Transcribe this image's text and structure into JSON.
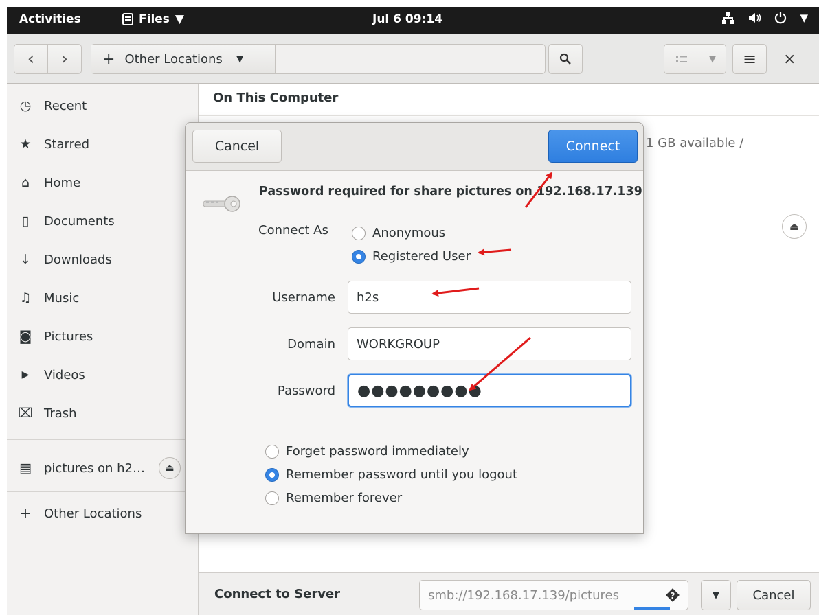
{
  "topbar": {
    "activities": "Activities",
    "app_menu": "Files",
    "clock": "Jul 6  09:14"
  },
  "headerbar": {
    "back_glyph": "‹",
    "forward_glyph": "›",
    "new_location_glyph": "+",
    "location": "Other Locations",
    "search_glyph": "⌕",
    "menu_glyph": "≡",
    "close_glyph": "×"
  },
  "sidebar": {
    "items": [
      {
        "label": "Recent",
        "icon": "clock-icon",
        "glyph": "◷"
      },
      {
        "label": "Starred",
        "icon": "star-icon",
        "glyph": "★"
      },
      {
        "label": "Home",
        "icon": "home-icon",
        "glyph": "⌂"
      },
      {
        "label": "Documents",
        "icon": "document-icon",
        "glyph": "▯"
      },
      {
        "label": "Downloads",
        "icon": "download-icon",
        "glyph": "↓"
      },
      {
        "label": "Music",
        "icon": "music-icon",
        "glyph": "♫"
      },
      {
        "label": "Pictures",
        "icon": "camera-icon",
        "glyph": "◙"
      },
      {
        "label": "Videos",
        "icon": "video-icon",
        "glyph": "▶"
      },
      {
        "label": "Trash",
        "icon": "trash-icon",
        "glyph": "⌧"
      }
    ],
    "mount": {
      "label": "pictures on h2…",
      "glyph": "▤"
    },
    "other_locations": {
      "label": "Other Locations",
      "glyph": "+"
    }
  },
  "main": {
    "section_title": "On This Computer",
    "available": "1 GB available    /",
    "connect_label": "Connect to Server",
    "server_address": "smb://192.168.17.139/pictures",
    "cancel": "Cancel"
  },
  "dialog": {
    "cancel": "Cancel",
    "connect": "Connect",
    "message": "Password required for share pictures on 192.168.17.139",
    "connect_as_label": "Connect As",
    "anonymous": "Anonymous",
    "registered_user": "Registered User",
    "username_label": "Username",
    "username_value": "h2s",
    "domain_label": "Domain",
    "domain_value": "WORKGROUP",
    "password_label": "Password",
    "password_mask": "●●●●●●●●●",
    "forget_password": "Forget password immediately",
    "remember_logout": "Remember password until you logout",
    "remember_forever": "Remember forever"
  },
  "colors": {
    "accent": "#3584e4",
    "annotation_arrow": "#e01b1b",
    "topbar": "#1b1b1b"
  }
}
